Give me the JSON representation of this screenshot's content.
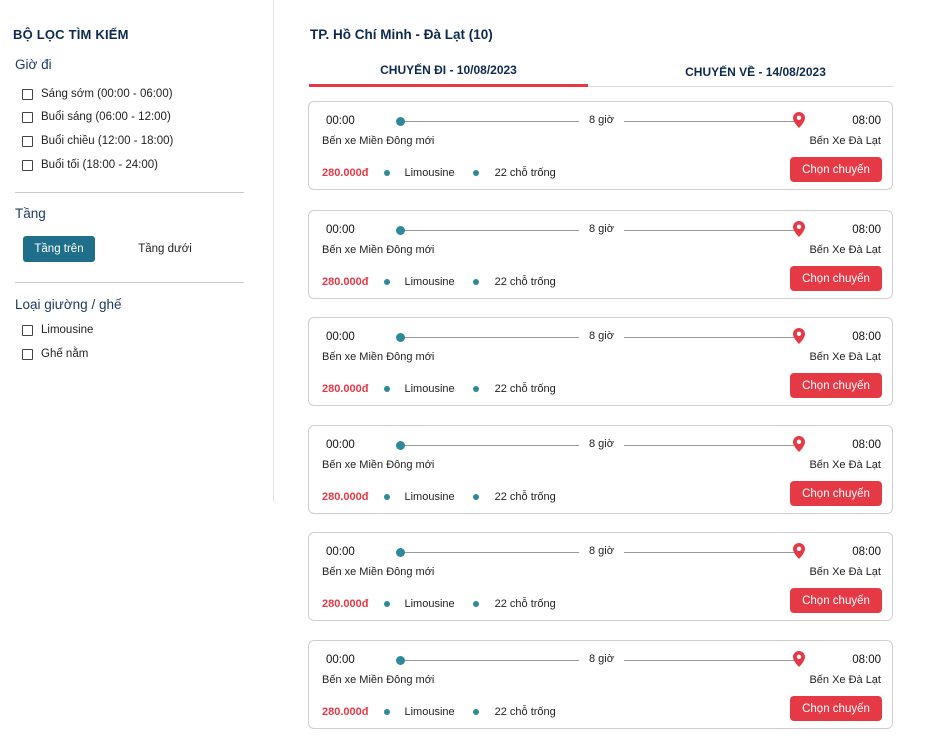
{
  "sidebar": {
    "title": "BỘ LỌC TÌM KIẾM",
    "time_section": {
      "heading": "Giờ đi",
      "options": [
        "Sáng sớm (00:00 - 06:00)",
        "Buổi sáng (06:00 - 12:00)",
        "Buổi chiều (12:00 - 18:00)",
        "Buổi tối (18:00 - 24:00)"
      ]
    },
    "floor_section": {
      "heading": "Tầng",
      "upper": "Tầng trên",
      "lower": "Tầng dưới",
      "selected": "Tầng trên"
    },
    "seat_section": {
      "heading": "Loại giường / ghế",
      "options": [
        "Limousine",
        "Ghế nằm"
      ]
    }
  },
  "main": {
    "route_title": "TP. Hồ Chí Minh - Đà Lạt (10)",
    "tabs": [
      {
        "label": "CHUYẾN ĐI - 10/08/2023",
        "active": true
      },
      {
        "label": "CHUYẾN VỀ - 14/08/2023",
        "active": false
      }
    ],
    "trips": [
      {
        "departure_time": "00:00",
        "arrival_time": "08:00",
        "duration": "8 giờ",
        "departure_station": "Bến xe Miền Đông mới",
        "arrival_station": "Bến Xe Đà Lạt",
        "price": "280.000đ",
        "vehicle": "Limousine",
        "seats": "22 chỗ trống",
        "button": "Chọn chuyến"
      },
      {
        "departure_time": "00:00",
        "arrival_time": "08:00",
        "duration": "8 giờ",
        "departure_station": "Bến xe Miền Đông mới",
        "arrival_station": "Bến Xe Đà Lạt",
        "price": "280.000đ",
        "vehicle": "Limousine",
        "seats": "22 chỗ trống",
        "button": "Chọn chuyến"
      },
      {
        "departure_time": "00:00",
        "arrival_time": "08:00",
        "duration": "8 giờ",
        "departure_station": "Bến xe Miền Đông mới",
        "arrival_station": "Bến Xe Đà Lạt",
        "price": "280.000đ",
        "vehicle": "Limousine",
        "seats": "22 chỗ trống",
        "button": "Chọn chuyến"
      },
      {
        "departure_time": "00:00",
        "arrival_time": "08:00",
        "duration": "8 giờ",
        "departure_station": "Bến xe Miền Đông mới",
        "arrival_station": "Bến Xe Đà Lạt",
        "price": "280.000đ",
        "vehicle": "Limousine",
        "seats": "22 chỗ trống",
        "button": "Chọn chuyến"
      },
      {
        "departure_time": "00:00",
        "arrival_time": "08:00",
        "duration": "8 giờ",
        "departure_station": "Bến xe Miền Đông mới",
        "arrival_station": "Bến Xe Đà Lạt",
        "price": "280.000đ",
        "vehicle": "Limousine",
        "seats": "22 chỗ trống",
        "button": "Chọn chuyến"
      },
      {
        "departure_time": "00:00",
        "arrival_time": "08:00",
        "duration": "8 giờ",
        "departure_station": "Bến xe Miền Đông mới",
        "arrival_station": "Bến Xe Đà Lạt",
        "price": "280.000đ",
        "vehicle": "Limousine",
        "seats": "22 chỗ trống",
        "button": "Chọn chuyến"
      }
    ]
  },
  "icons": {
    "pin": "map-pin-icon",
    "dot": "route-dot-icon",
    "checkbox": "checkbox-icon"
  },
  "colors": {
    "primary_navy": "#0d2a4e",
    "accent_red": "#e63946",
    "teal": "#1f6f8b",
    "dot_teal": "#2e8a9a"
  }
}
